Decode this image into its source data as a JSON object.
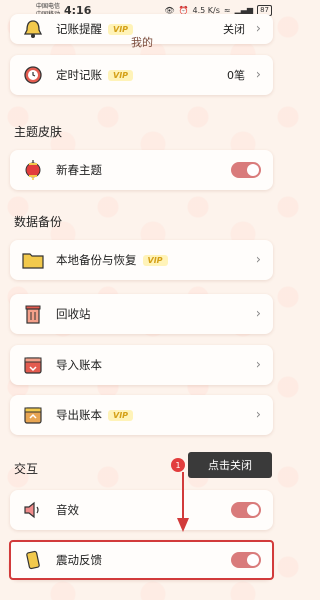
{
  "status_bar": {
    "carrier_1": "中国电信",
    "carrier_2": "中国移动",
    "time": "4:16",
    "net_speed": "4.5 K/s",
    "battery": "87"
  },
  "page_title": "我的",
  "rows_top": [
    {
      "label": "记账提醒",
      "vip": "VIP",
      "value": "关闭",
      "icon": "bell-icon"
    },
    {
      "label": "定时记账",
      "vip": "VIP",
      "value": "0笔",
      "icon": "clock-icon"
    }
  ],
  "sections": {
    "theme": "主题皮肤",
    "backup": "数据备份",
    "interaction": "交互"
  },
  "theme_row": {
    "label": "新春主题",
    "icon": "lantern-icon",
    "enabled": true
  },
  "backup_rows": [
    {
      "label": "本地备份与恢复",
      "vip": "VIP",
      "icon": "folder-icon"
    },
    {
      "label": "回收站",
      "vip": "",
      "icon": "trash-icon"
    },
    {
      "label": "导入账本",
      "vip": "",
      "icon": "import-icon"
    },
    {
      "label": "导出账本",
      "vip": "VIP",
      "icon": "export-icon"
    }
  ],
  "interaction_rows": [
    {
      "label": "音效",
      "icon": "speaker-icon",
      "enabled": true
    },
    {
      "label": "震动反馈",
      "icon": "phone-vibrate-icon",
      "enabled": true
    }
  ],
  "overlay": {
    "badge": "1",
    "tooltip": "点击关闭"
  },
  "colors": {
    "toggle_on": "#d97b7b",
    "highlight": "#d23b3b",
    "vip_text": "#d4a017"
  }
}
